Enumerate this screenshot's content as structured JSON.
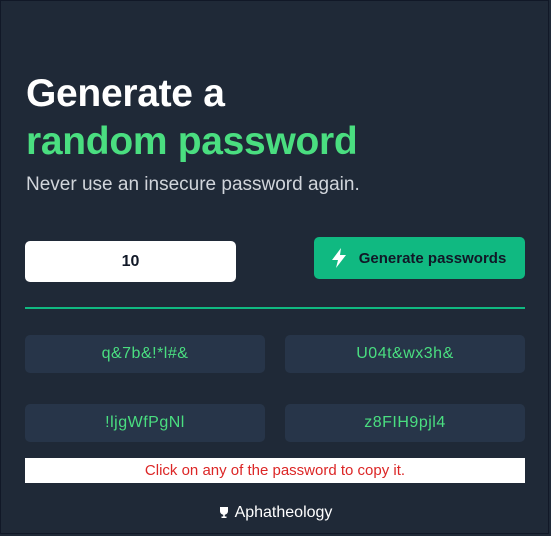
{
  "header": {
    "title_line1": "Generate a",
    "title_line2": "random password",
    "subtitle": "Never use an insecure password again."
  },
  "controls": {
    "length_value": "10",
    "generate_label": "Generate passwords",
    "generate_icon": "bolt-icon"
  },
  "passwords": [
    "q&7b&!*l#&",
    "U04t&wx3h&",
    "!ljgWfPgNl",
    "z8FIH9pjl4"
  ],
  "notice": "Click on any of the password to copy it.",
  "footer": {
    "brand": "Aphatheology",
    "icon": "trophy-icon"
  },
  "colors": {
    "background": "#1f2937",
    "accent": "#4ade80",
    "button": "#10b981",
    "card": "#273549",
    "notice_text": "#dc2626"
  }
}
